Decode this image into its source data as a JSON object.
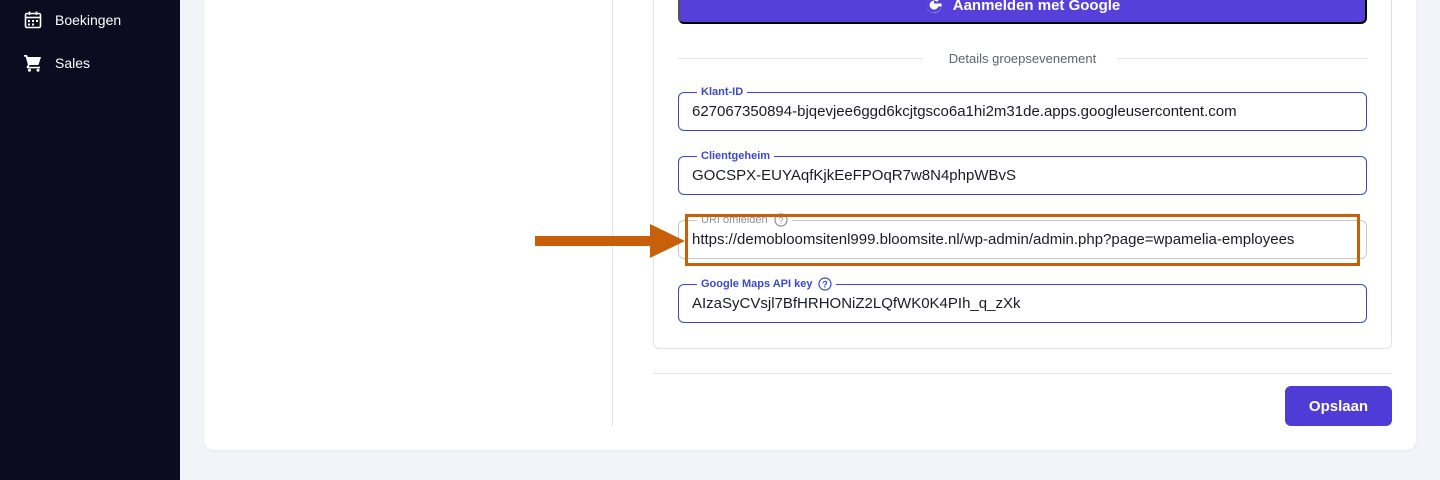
{
  "sidebar": {
    "items": [
      {
        "label": "Boekingen",
        "icon": "calendar-icon"
      },
      {
        "label": "Sales",
        "icon": "cart-icon"
      }
    ]
  },
  "auth": {
    "google_button_label": "Aanmelden met Google"
  },
  "section": {
    "title": "Details groepsevenement"
  },
  "fields": {
    "client_id": {
      "label": "Klant-ID",
      "value": "627067350894-bjqevjee6ggd6kcjtgsco6a1hi2m31de.apps.googleusercontent.com"
    },
    "client_secret": {
      "label": "Clientgeheim",
      "value": "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"
    },
    "redirect_uri": {
      "label": "URI omleiden",
      "value": "https://demobloomsitenl999.bloomsite.nl/wp-admin/admin.php?page=wpamelia-employees"
    },
    "maps_key": {
      "label": "Google Maps API key",
      "value": "AIzaSyCVsjl7BfHRHONiZ2LQfWK0K4PIh_q_zXk"
    }
  },
  "footer": {
    "save_label": "Opslaan"
  },
  "colors": {
    "sidebar_bg": "#0b0c1f",
    "accent": "#4f3cd6",
    "field_border": "#3d48c8",
    "annotation": "#c8600a"
  }
}
